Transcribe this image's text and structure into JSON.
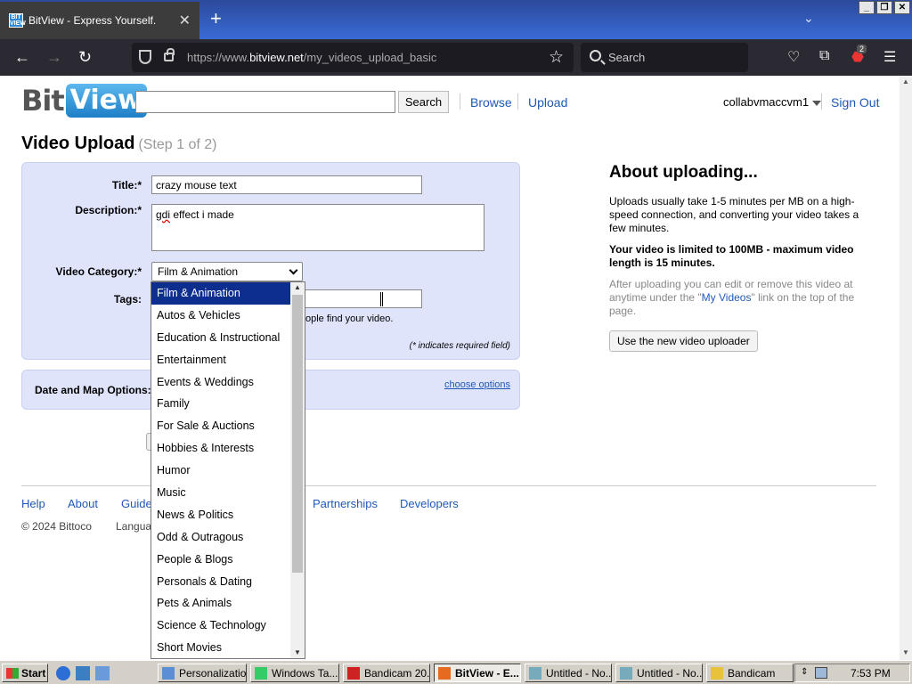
{
  "browser": {
    "tab_title": "BitView - Express Yourself.",
    "url_prefix": "https://www.",
    "url_domain": "bitview.net",
    "url_path": "/my_videos_upload_basic",
    "search_placeholder": "Search",
    "extension_badge": "2",
    "favicon_text": "BIT VIEW"
  },
  "site": {
    "logo_bit": "Bit",
    "logo_view": "View",
    "search_button": "Search",
    "nav": {
      "browse": "Browse",
      "upload": "Upload"
    },
    "user": {
      "name": "collabvmaccvm1",
      "sign_out": "Sign Out"
    }
  },
  "upload": {
    "heading": "Video Upload",
    "step": "(Step 1 of 2)",
    "title_label": "Title:*",
    "title_value": "crazy mouse text",
    "description_label": "Description:*",
    "description_spell": "gdi",
    "description_rest": " effect i made",
    "category_label": "Video Category:*",
    "category_value": "Film & Animation",
    "tags_label": "Tags:",
    "tags_hint": "ople find your video.",
    "required_note": "(* indicates required field)",
    "date_map_label": "Date and Map Options:",
    "choose_options": "choose options"
  },
  "about": {
    "title": "About uploading...",
    "p1": "Uploads usually take 1-5 minutes per MB on a high-speed connection, and converting your video takes a few minutes.",
    "p2": "Your video is limited to 100MB - maximum video length is 15 minutes.",
    "p3_before": "After uploading you can edit or remove this video at anytime under the \"",
    "p3_link": "My Videos",
    "p3_after": "\" link on the top of the page.",
    "new_uploader_button": "Use the new video uploader"
  },
  "footer": {
    "help": "Help",
    "about": "About",
    "guide_partial": "Guide",
    "partnerships": "Partnerships",
    "developers": "Developers",
    "copyright": "© 2024 Bittoco",
    "language_partial": "Langua"
  },
  "dropdown": {
    "options": [
      "Film & Animation",
      "Autos & Vehicles",
      "Education & Instructional",
      "Entertainment",
      "Events & Weddings",
      "Family",
      "For Sale & Auctions",
      "Hobbies & Interests",
      "Humor",
      "Music",
      "News & Politics",
      "Odd & Outragous",
      "People & Blogs",
      "Personals & Dating",
      "Pets & Animals",
      "Science & Technology",
      "Short Movies"
    ],
    "selected_index": 0
  },
  "taskbar": {
    "start": "Start",
    "tasks": [
      {
        "label": "Personalization"
      },
      {
        "label": "Windows Ta..."
      },
      {
        "label": "Bandicam 20..."
      },
      {
        "label": "BitView - E...",
        "active": true
      },
      {
        "label": "Untitled - No..."
      },
      {
        "label": "Untitled - No..."
      },
      {
        "label": "Bandicam"
      }
    ],
    "clock": "7:53 PM"
  },
  "colors": {
    "link": "#1f59b8",
    "panel": "#dfe4fb",
    "selected_option": "#0d2d8f"
  }
}
